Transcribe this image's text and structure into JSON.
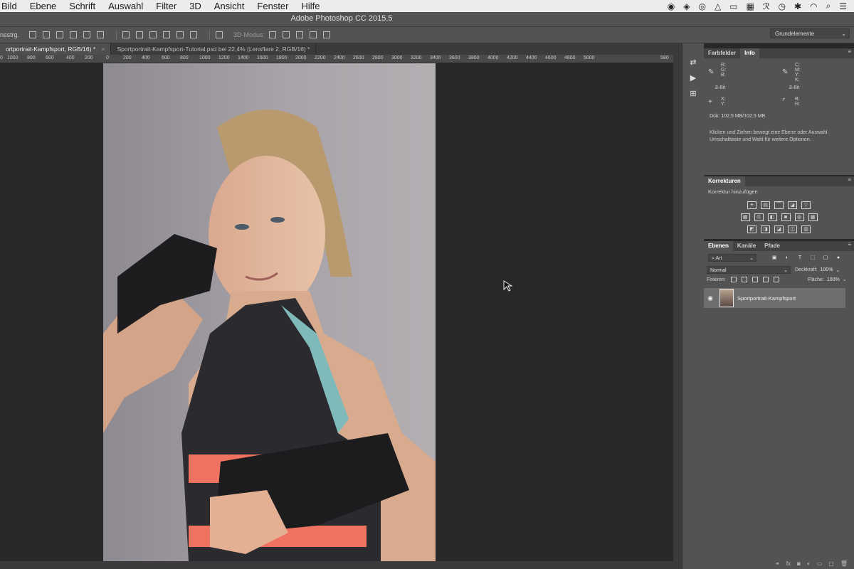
{
  "menubar": {
    "items": [
      "Bild",
      "Ebene",
      "Schrift",
      "Auswahl",
      "Filter",
      "3D",
      "Ansicht",
      "Fenster",
      "Hilfe"
    ]
  },
  "titlebar": {
    "title": "Adobe Photoshop CC 2015.5"
  },
  "options": {
    "tool_label": "nsstrg.",
    "mode_label": "3D-Modus:",
    "workspace": "Grundelemente"
  },
  "tabs": [
    {
      "label": "ortportrait-Kampfsport, RGB/16) *",
      "active": true
    },
    {
      "label": "Sportportrait-Kampfsport-Tutorial.psd bei 22,4% (Lensflare 2, RGB/16) *",
      "active": false
    }
  ],
  "ruler": {
    "ticks": [
      "0",
      "1000",
      "800",
      "600",
      "400",
      "200",
      "0",
      "200",
      "400",
      "600",
      "800",
      "1000",
      "1200",
      "1400",
      "1600",
      "1800",
      "2000",
      "2200",
      "2400",
      "2600",
      "2800",
      "3000",
      "3200",
      "3400",
      "3600",
      "3800",
      "4000",
      "4200",
      "4400",
      "4600",
      "4800",
      "5000",
      "580"
    ]
  },
  "info_panel": {
    "tabs": [
      "Farbfelder",
      "Info"
    ],
    "rgb": [
      "R:",
      "G:",
      "B:"
    ],
    "bit_left": "8-Bit",
    "cmyk": [
      "C:",
      "M:",
      "Y:",
      "K:"
    ],
    "bit_right": "8-Bit",
    "xy": [
      "X:",
      "Y:"
    ],
    "bh": [
      "B:",
      "H:"
    ],
    "doc": "Dok: 102,5 MB/102,5 MB",
    "help": "Klicken und Ziehen bewegt eine Ebene oder Auswahl. Umschalttaste und Wahl für weitere Optionen."
  },
  "korrekturen": {
    "title": "Korrekturen",
    "subtitle": "Korrektur hinzufügen"
  },
  "layers": {
    "tabs": [
      "Ebenen",
      "Kanäle",
      "Pfade"
    ],
    "kind_filter": "Art",
    "blend_mode": "Normal",
    "opacity_label": "Deckkraft:",
    "opacity_value": "100%",
    "lock_label": "Fixieren:",
    "fill_label": "Fläche:",
    "fill_value": "100%",
    "items": [
      {
        "name": "Sportportrait-Kampfsport"
      }
    ]
  }
}
